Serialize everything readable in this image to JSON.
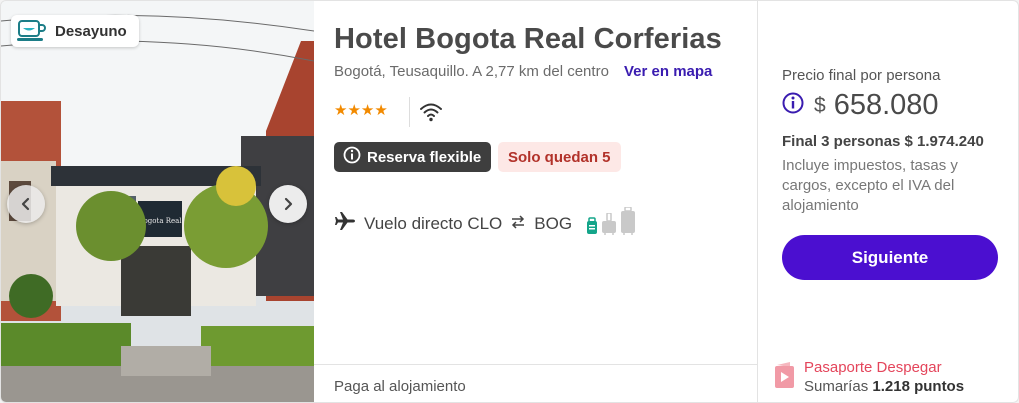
{
  "image": {
    "badge_label": "Desayuno",
    "badge_icon": "coffee-cup-icon",
    "prev_icon": "chevron-left-icon",
    "next_icon": "chevron-right-icon"
  },
  "hotel": {
    "name": "Hotel Bogota Real Corferias",
    "location": "Bogotá, Teusaquillo. A 2,77 km del centro",
    "map_link": "Ver en mapa",
    "stars": 4,
    "stars_text": "★★★★",
    "amenity_icon": "wifi-icon"
  },
  "tags": {
    "flexible": "Reserva flexible",
    "flexible_icon": "info-circle-icon",
    "availability": "Solo quedan 5"
  },
  "flight": {
    "icon": "airplane-icon",
    "text": "Vuelo directo CLO",
    "route_icon": "swap-arrows-icon",
    "destination": "BOG",
    "bag_icons": [
      "personal-bag-icon",
      "carry-on-icon",
      "checked-bag-icon"
    ]
  },
  "payment": {
    "label": "Paga al alojamiento"
  },
  "price": {
    "label": "Precio final por persona",
    "info_icon": "info-circle-icon",
    "currency": "$",
    "amount": "658.080",
    "total": "Final 3 personas $ 1.974.240",
    "taxes": "Incluye impuestos, tasas y cargos, excepto el IVA del alojamiento",
    "cta": "Siguiente"
  },
  "passport": {
    "icon": "passport-icon",
    "title": "Pasaporte Despegar",
    "points_prefix": "Sumarías",
    "points": "1.218 puntos"
  },
  "colors": {
    "brand": "#4b0fd0",
    "link": "#3a1cb0",
    "star": "#f28a00",
    "alert_bg": "#fde8e6",
    "alert_text": "#b2322a",
    "passport": "#e4455b"
  }
}
